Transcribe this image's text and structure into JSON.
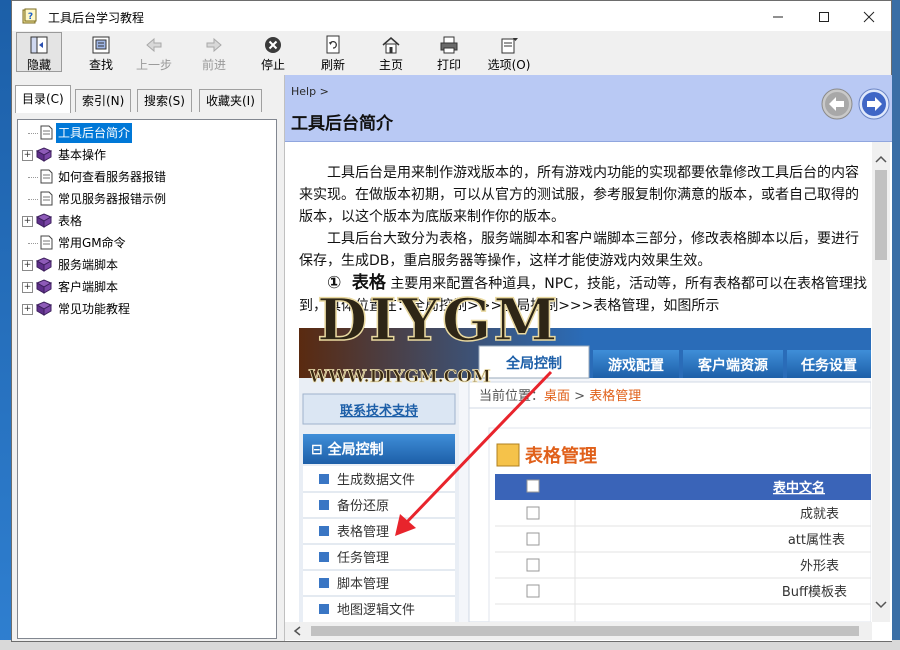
{
  "window": {
    "title": "工具后台学习教程"
  },
  "toolbar": {
    "hide": "隐藏",
    "find": "查找",
    "back": "上一步",
    "forward": "前进",
    "stop": "停止",
    "refresh": "刷新",
    "home": "主页",
    "print": "打印",
    "options": "选项(O)"
  },
  "tabs": [
    "目录(C)",
    "索引(N)",
    "搜索(S)",
    "收藏夹(I)"
  ],
  "tree": [
    {
      "label": "工具后台简介",
      "icon": "page",
      "expandable": false,
      "selected": true
    },
    {
      "label": "基本操作",
      "icon": "book",
      "expandable": true
    },
    {
      "label": "如何查看服务器报错",
      "icon": "page",
      "expandable": false
    },
    {
      "label": "常见服务器报错示例",
      "icon": "page",
      "expandable": false
    },
    {
      "label": "表格",
      "icon": "book",
      "expandable": true
    },
    {
      "label": "常用GM命令",
      "icon": "page",
      "expandable": false
    },
    {
      "label": "服务端脚本",
      "icon": "book",
      "expandable": true
    },
    {
      "label": "客户端脚本",
      "icon": "book",
      "expandable": true
    },
    {
      "label": "常见功能教程",
      "icon": "book",
      "expandable": true
    }
  ],
  "header": {
    "breadcrumb": "Help >",
    "title": "工具后台简介"
  },
  "content": {
    "para1": "工具后台是用来制作游戏版本的，所有游戏内功能的实现都要依靠修改工具后台的内容来实现。在做版本初期，可以从官方的测试服，参考服复制你满意的版本，或者自己取得的版本，以这个版本为底版来制作你的版本。",
    "para2": "工具后台大致分为表格，服务端脚本和客户端脚本三部分，修改表格脚本以后，要进行保存，生成DB，重启服务器等操作，这样才能使游戏内效果生效。",
    "section_num": "①",
    "section_title": "表格",
    "section_text": "主要用来配置各种道具，NPC，技能，活动等，所有表格都可以在表格管理找到，具体位置在：全局控制>>>全局控制>>>表格管理，如图所示"
  },
  "watermark": {
    "logo": "DIYGM",
    "site": "WWW.DIYGM.COM"
  },
  "screenshot": {
    "top_tabs": [
      "全局控制",
      "游戏配置",
      "客户端资源",
      "任务设置"
    ],
    "support_link": "联系技术支持",
    "menu_header": "⊟ 全局控制",
    "menu_items": [
      "生成数据文件",
      "备份还原",
      "表格管理",
      "任务管理",
      "脚本管理",
      "地图逻辑文件"
    ],
    "location_prefix": "当前位置：",
    "location_home": "桌面",
    "location_sep": " > ",
    "location_page": "表格管理",
    "panel_title": "表格管理",
    "table_header": "表中文名",
    "rows": [
      "成就表",
      "att属性表",
      "外形表",
      "Buff模板表"
    ]
  }
}
